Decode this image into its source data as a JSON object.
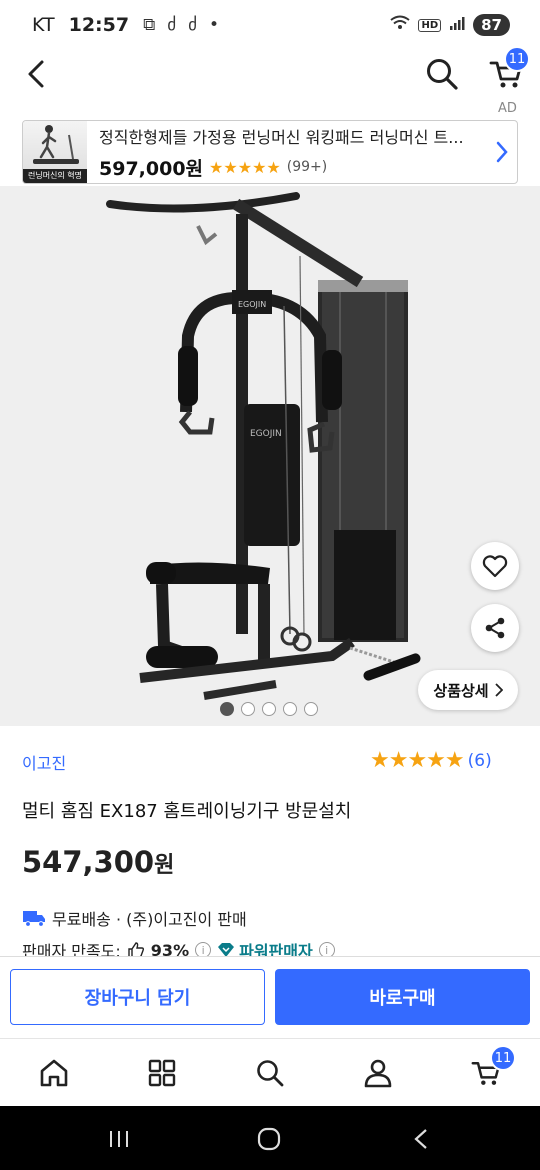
{
  "status": {
    "carrier": "KT",
    "time": "12:57",
    "battery": "87",
    "hd": "HD"
  },
  "header": {
    "cart_count": "11"
  },
  "ad": {
    "label": "AD",
    "title": "정직한형제들 가정용 런닝머신 워킹패드 러닝머신 트...",
    "price": "597,000원",
    "stars": "★★★★★",
    "review_count": "(99+)",
    "thumb_tag": "런닝머신의 혁명"
  },
  "gallery": {
    "detail_label": "상품상세",
    "image_count": 5,
    "active_index": 0,
    "machine_logo": "EGOJIN"
  },
  "product": {
    "brand": "이고진",
    "rating_stars": "★★★★★",
    "review_count": "(6)",
    "name": "멀티 홈짐 EX187 홈트레이닝기구 방문설치",
    "price_number": "547,300",
    "price_unit": "원",
    "shipping": "무료배송 · (주)이고진이 판매",
    "satisfaction_label": "판매자 만족도:",
    "satisfaction_value": "93%",
    "power_seller": "파워판매자"
  },
  "actions": {
    "add_to_cart": "장바구니 담기",
    "buy_now": "바로구매"
  },
  "bottom_nav": {
    "cart_count": "11"
  },
  "colors": {
    "accent": "#346aff",
    "star": "#f6a312",
    "power": "#0a7c8a"
  }
}
